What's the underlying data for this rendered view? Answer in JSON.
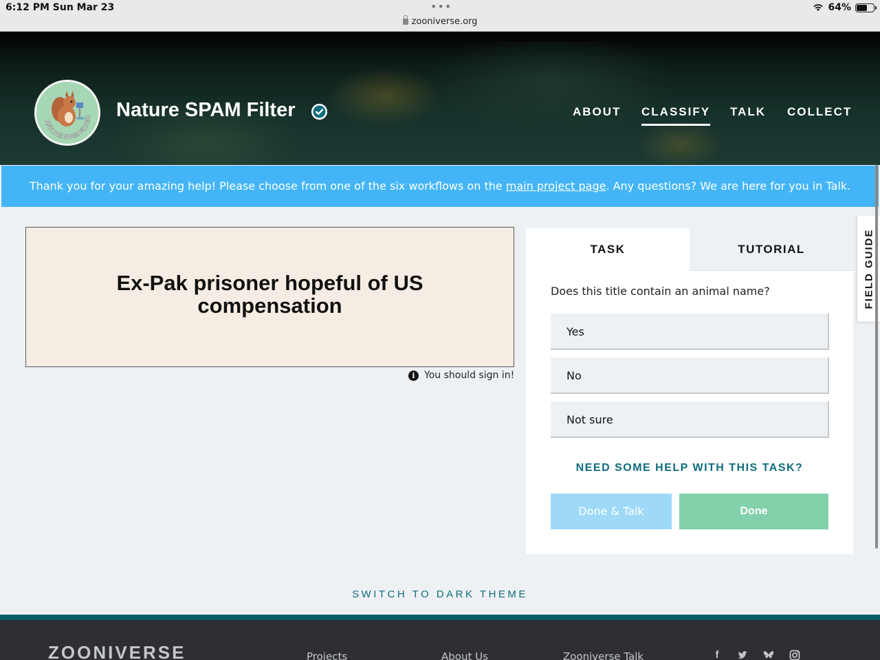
{
  "status_bar": {
    "time": "6:12 PM   Sun Mar 23",
    "dots": "•••",
    "url": "zooniverse.org",
    "battery": "64%"
  },
  "project": {
    "title": "Nature SPAM Filter",
    "logo_text": "NATURE SPAM FILTER"
  },
  "nav": {
    "about": "ABOUT",
    "classify": "CLASSIFY",
    "talk": "TALK",
    "collect": "COLLECT"
  },
  "banner": {
    "text_before": "Thank you for your amazing help! Please choose from one of the six workflows on the ",
    "link": "main project page",
    "text_after": ". Any questions? We are here for you in Talk."
  },
  "subject": {
    "title_line1": "Ex-Pak prisoner hopeful of US",
    "title_line2": "compensation",
    "signin_note": "You should sign in!"
  },
  "task_panel": {
    "tab_task": "TASK",
    "tab_tutorial": "TUTORIAL",
    "question": "Does this title contain an animal name?",
    "answers": [
      "Yes",
      "No",
      "Not sure"
    ],
    "help": "NEED SOME HELP WITH THIS TASK?",
    "done_talk": "Done & Talk",
    "done": "Done"
  },
  "field_guide": "FIELD GUIDE",
  "theme_switch": "SWITCH TO DARK THEME",
  "footer": {
    "logo": "ZOONIVERSE",
    "links": [
      "Projects",
      "About Us",
      "Zooniverse Talk"
    ],
    "social_icons": [
      "facebook-icon",
      "twitter-icon",
      "bluesky-icon",
      "instagram-icon"
    ]
  },
  "colors": {
    "banner": "#43b5f7",
    "done": "#82d1ab",
    "done_talk": "#9fd9f8",
    "accent_teal": "#0f6c7c",
    "footer": "#2d2f32"
  }
}
